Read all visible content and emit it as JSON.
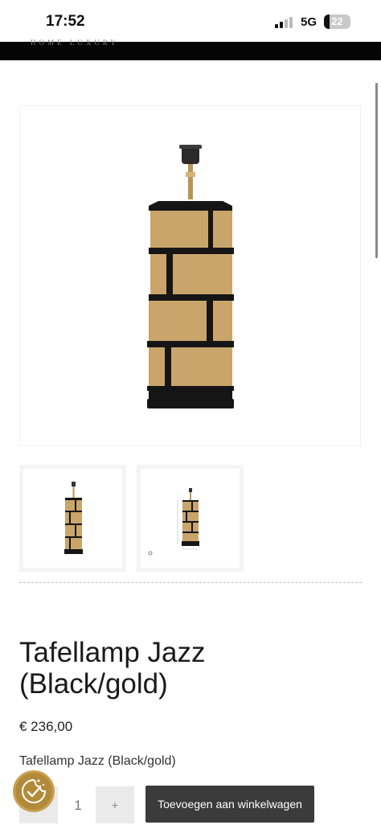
{
  "status_bar": {
    "time": "17:52",
    "network": "5G",
    "battery": "22",
    "battery_level": 0.22
  },
  "header": {
    "brand_tagline": "HOME LUXURY"
  },
  "product": {
    "title_line1": "Tafellamp Jazz",
    "title_line2": "(Black/gold)",
    "price": "€ 236,00",
    "variant_name": "Tafellamp Jazz (Black/gold)",
    "quantity": "1",
    "minus_label": "-",
    "plus_label": "+",
    "add_to_cart_label": "Toevoegen aan winkelwagen"
  },
  "gallery": {
    "thumbnail_count": 2
  },
  "colors": {
    "gold": "#c9a56b",
    "black": "#151515",
    "button": "#3b3b3b"
  },
  "icons": {
    "consent": "cookie-consent-icon"
  }
}
